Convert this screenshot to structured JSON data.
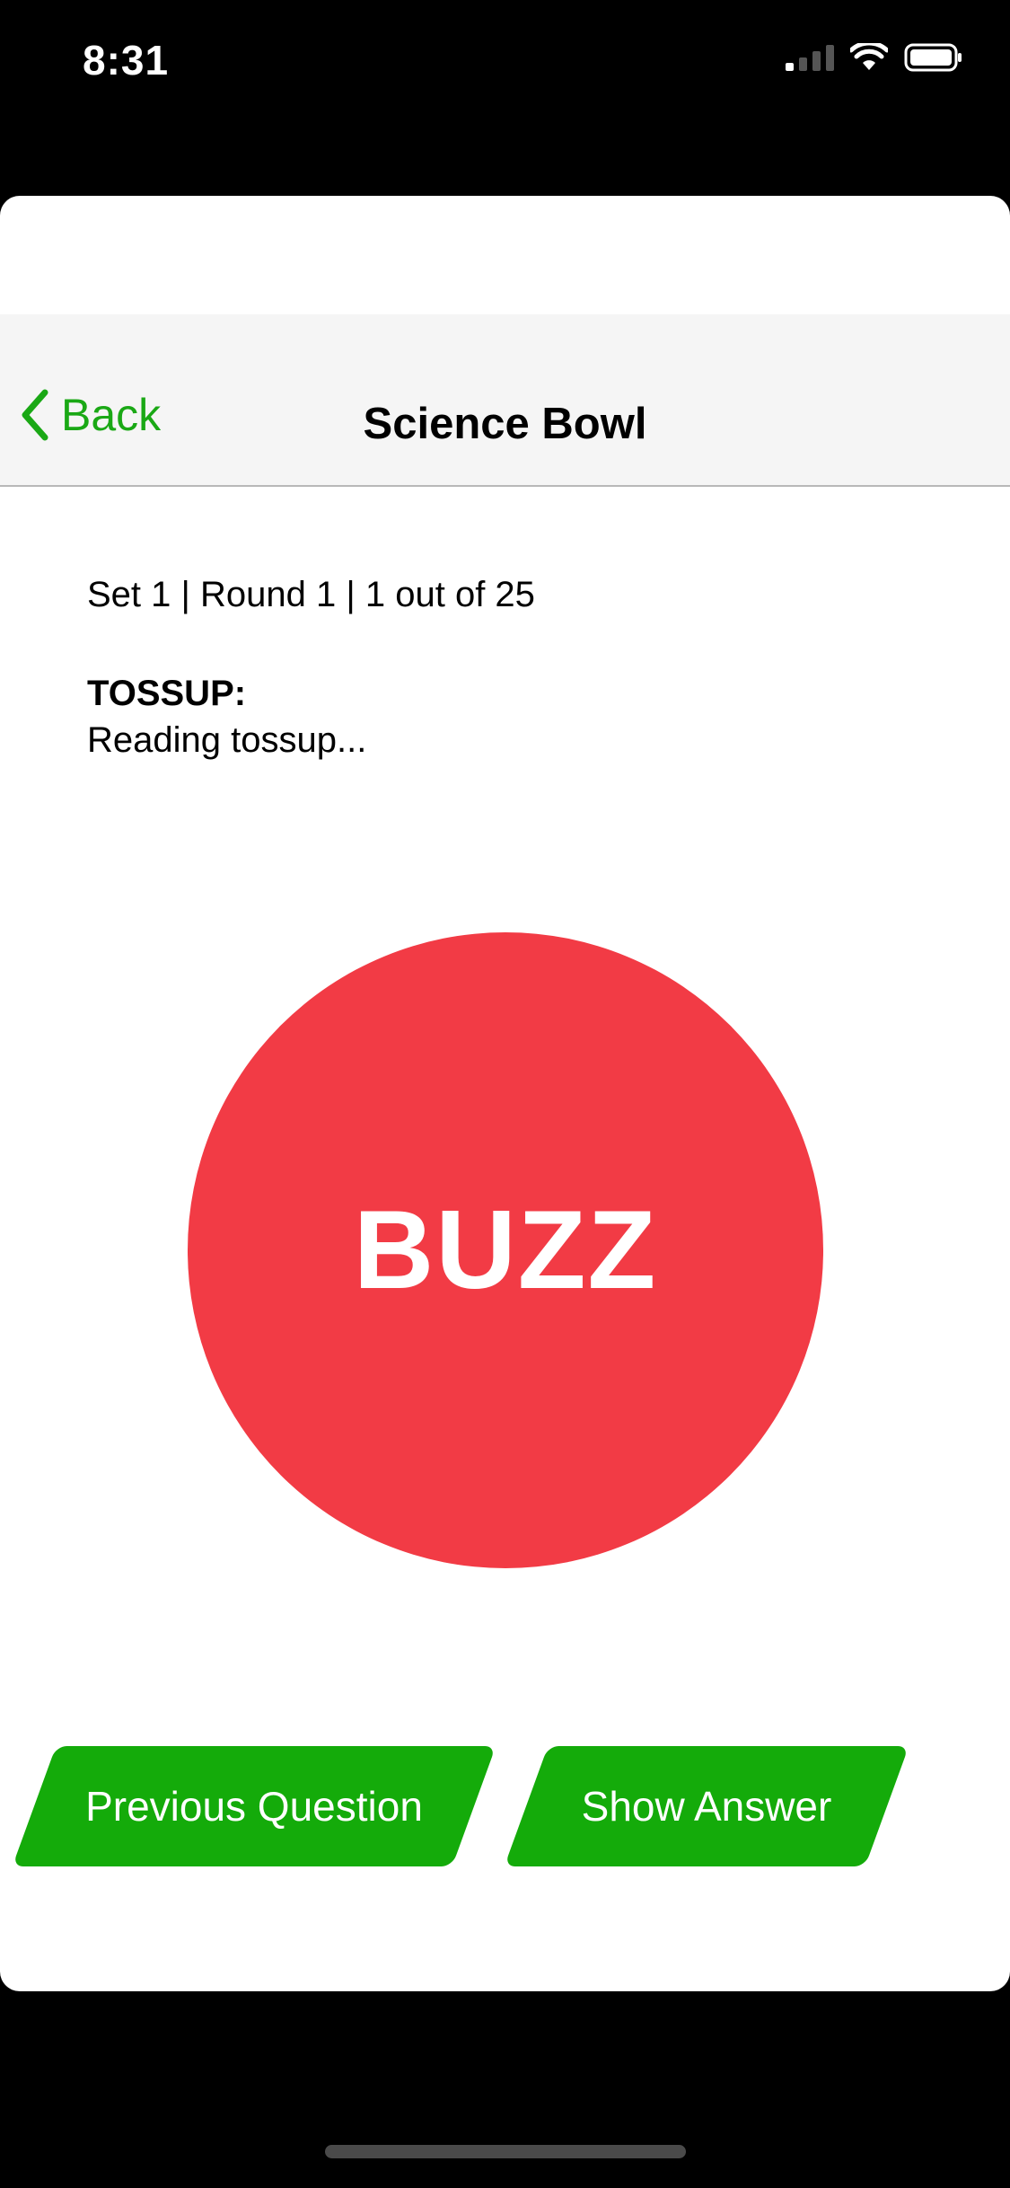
{
  "status_bar": {
    "time": "8:31"
  },
  "nav": {
    "back_label": "Back",
    "title": "Science Bowl"
  },
  "question": {
    "info": "Set 1 | Round 1 | 1 out of 25",
    "type_label": "TOSSUP:",
    "text": "Reading tossup..."
  },
  "buzz": {
    "label": "BUZZ"
  },
  "actions": {
    "previous_label": "Previous Question",
    "show_answer_label": "Show Answer"
  },
  "colors": {
    "accent_green": "#1aa815",
    "button_green": "#14ab0a",
    "buzz_red": "#f23b45"
  },
  "icons": {
    "back": "chevron-left-icon",
    "signal": "cellular-signal-icon",
    "wifi": "wifi-icon",
    "battery": "battery-icon"
  }
}
